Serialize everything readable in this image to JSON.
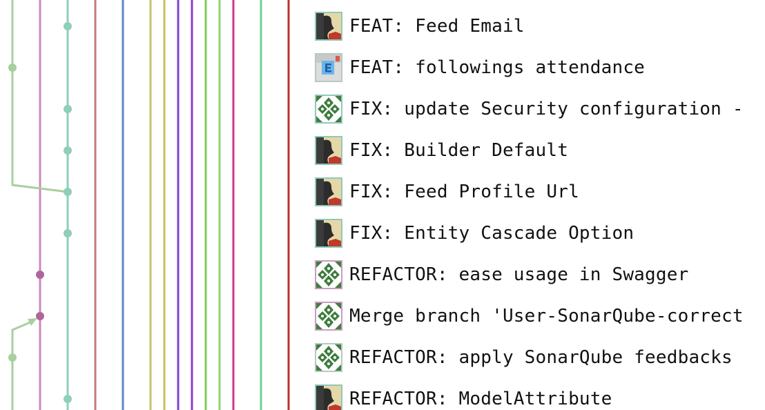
{
  "colors": {
    "lane_pink": "#cc88bb",
    "lane_teal": "#8ecfb9",
    "lane_sage": "#a8cfa0",
    "lane_brick": "#c27b78",
    "lane_blue": "#5c86c9",
    "lane_olive": "#c7c26a",
    "lane_gold": "#c8be5a",
    "lane_violet": "#7a47c8",
    "lane_purple": "#8c3ec7",
    "lane_green": "#7ccc58",
    "lane_lime": "#8fd46a",
    "lane_magenta": "#c83a8a",
    "lane_mint": "#6fcf97",
    "lane_red": "#b8322b",
    "node_teal": "#8ecfb9",
    "node_mauve": "#b0659a",
    "node_sage": "#a8cfa0"
  },
  "commits": [
    {
      "message": "FEAT: Feed Email",
      "avatar": "user-avatar-portrait"
    },
    {
      "message": "FEAT: followings attendance",
      "avatar": "user-avatar-letter-e"
    },
    {
      "message": "FIX: update Security configuration -",
      "avatar": "user-avatar-identicon"
    },
    {
      "message": "FIX: Builder Default",
      "avatar": "user-avatar-portrait"
    },
    {
      "message": "FIX: Feed Profile Url",
      "avatar": "user-avatar-portrait"
    },
    {
      "message": "FIX: Entity Cascade Option",
      "avatar": "user-avatar-portrait"
    },
    {
      "message": "REFACTOR: ease usage in Swagger",
      "avatar": "user-avatar-identicon"
    },
    {
      "message": "Merge branch 'User-SonarQube-correct",
      "avatar": "user-avatar-identicon"
    },
    {
      "message": "REFACTOR: apply SonarQube feedbacks",
      "avatar": "user-avatar-identicon"
    },
    {
      "message": "REFACTOR: ModelAttribute",
      "avatar": "user-avatar-portrait"
    }
  ]
}
